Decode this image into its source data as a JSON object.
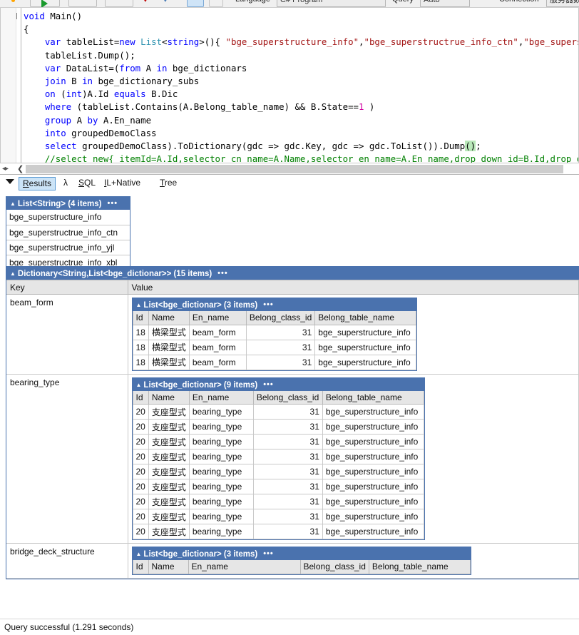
{
  "toolbar": {
    "language_label": "Language",
    "language_value": "C# Program",
    "query_label": "Query",
    "query_value": "Auto",
    "connection_label": "Connection",
    "connection_value": "服务器数据库 ▼",
    "icons": [
      "status-dot",
      "run-icon",
      "stop-icon",
      "cancel-icon",
      "linq-icon",
      "lambda-icon",
      "grid-icon",
      "columns-icon"
    ]
  },
  "editor": {
    "lines": [
      [
        {
          "t": "void ",
          "c": "kw"
        },
        {
          "t": "Main()",
          "c": ""
        }
      ],
      [
        {
          "t": "{",
          "c": ""
        }
      ],
      [
        {
          "t": "    ",
          "c": ""
        },
        {
          "t": "var",
          "c": "kw"
        },
        {
          "t": " tableList=",
          "c": ""
        },
        {
          "t": "new",
          "c": "kw"
        },
        {
          "t": " ",
          "c": ""
        },
        {
          "t": "List",
          "c": "kw2"
        },
        {
          "t": "<",
          "c": ""
        },
        {
          "t": "string",
          "c": "kw"
        },
        {
          "t": ">(){ ",
          "c": ""
        },
        {
          "t": "\"bge_superstructure_info\"",
          "c": "str"
        },
        {
          "t": ",",
          "c": ""
        },
        {
          "t": "\"bge_superstructrue_info_ctn\"",
          "c": "str"
        },
        {
          "t": ",",
          "c": ""
        },
        {
          "t": "\"bge_superstruct",
          "c": "str"
        }
      ],
      [
        {
          "t": "    tableList.Dump();",
          "c": ""
        }
      ],
      [
        {
          "t": "    ",
          "c": ""
        },
        {
          "t": "var",
          "c": "kw"
        },
        {
          "t": " DataList=(",
          "c": ""
        },
        {
          "t": "from",
          "c": "kw"
        },
        {
          "t": " A ",
          "c": ""
        },
        {
          "t": "in",
          "c": "kw"
        },
        {
          "t": " bge_dictionars",
          "c": ""
        }
      ],
      [
        {
          "t": "    ",
          "c": ""
        },
        {
          "t": "join",
          "c": "kw"
        },
        {
          "t": " B ",
          "c": ""
        },
        {
          "t": "in",
          "c": "kw"
        },
        {
          "t": " bge_dictionary_subs",
          "c": ""
        }
      ],
      [
        {
          "t": "    ",
          "c": ""
        },
        {
          "t": "on",
          "c": "kw"
        },
        {
          "t": " (",
          "c": ""
        },
        {
          "t": "int",
          "c": "kw"
        },
        {
          "t": ")A.Id ",
          "c": ""
        },
        {
          "t": "equals",
          "c": "kw"
        },
        {
          "t": " B.Dic",
          "c": ""
        }
      ],
      [
        {
          "t": "    ",
          "c": ""
        },
        {
          "t": "where",
          "c": "kw"
        },
        {
          "t": " (tableList.Contains(A.Belong_table_name) && B.State==",
          "c": ""
        },
        {
          "t": "1",
          "c": "num"
        },
        {
          "t": " )",
          "c": ""
        }
      ],
      [
        {
          "t": "    ",
          "c": ""
        },
        {
          "t": "group",
          "c": "kw"
        },
        {
          "t": " A ",
          "c": ""
        },
        {
          "t": "by",
          "c": "kw"
        },
        {
          "t": " A.En_name",
          "c": ""
        }
      ],
      [
        {
          "t": "    ",
          "c": ""
        },
        {
          "t": "into",
          "c": "kw"
        },
        {
          "t": " groupedDemoClass",
          "c": ""
        }
      ],
      [
        {
          "t": "    ",
          "c": ""
        },
        {
          "t": "select",
          "c": "kw"
        },
        {
          "t": " groupedDemoClass).ToDictionary(gdc => gdc.Key, gdc => gdc.ToList()).Dump",
          "c": ""
        },
        {
          "t": "()",
          "c": "hl"
        },
        {
          "t": ";",
          "c": ""
        }
      ],
      [
        {
          "t": "    //select new{ itemId=A.Id,selector_cn_name=A.Name,selector_en_name=A.En_name,drop_down_id=B.Id,drop_down_",
          "c": "cmt"
        }
      ]
    ]
  },
  "tabs": {
    "items": [
      {
        "label": "Results",
        "underline": "R",
        "active": true
      },
      {
        "label": "λ",
        "underline": "",
        "active": false
      },
      {
        "label": "SQL",
        "underline": "S",
        "active": false
      },
      {
        "label": "IL+Native",
        "underline": "I",
        "active": false
      },
      {
        "label": "Tree",
        "underline": "T",
        "active": false
      }
    ]
  },
  "results": {
    "string_list": {
      "title": "List<String> (4 items)",
      "dots": "•••",
      "items": [
        "bge_superstructure_info",
        "bge_superstructrue_info_ctn",
        "bge_superstructrue_info_yjl",
        "bge_superstructrue_info_xbl"
      ]
    },
    "dictionary": {
      "title": "Dictionary<String,List<bge_dictionar>> (15 items)",
      "dots": "•••",
      "key_header": "Key",
      "value_header": "Value",
      "columns": [
        "Id",
        "Name",
        "En_name",
        "Belong_class_id",
        "Belong_table_name"
      ],
      "entries": [
        {
          "key": "beam_form",
          "inner_title": "List<bge_dictionar> (3 items)",
          "dots": "•••",
          "rows": [
            [
              "18",
              "横梁型式",
              "beam_form",
              "31",
              "bge_superstructure_info"
            ],
            [
              "18",
              "横梁型式",
              "beam_form",
              "31",
              "bge_superstructure_info"
            ],
            [
              "18",
              "横梁型式",
              "beam_form",
              "31",
              "bge_superstructure_info"
            ]
          ]
        },
        {
          "key": "bearing_type",
          "inner_title": "List<bge_dictionar> (9 items)",
          "dots": "•••",
          "rows": [
            [
              "20",
              "支座型式",
              "bearing_type",
              "31",
              "bge_superstructure_info"
            ],
            [
              "20",
              "支座型式",
              "bearing_type",
              "31",
              "bge_superstructure_info"
            ],
            [
              "20",
              "支座型式",
              "bearing_type",
              "31",
              "bge_superstructure_info"
            ],
            [
              "20",
              "支座型式",
              "bearing_type",
              "31",
              "bge_superstructure_info"
            ],
            [
              "20",
              "支座型式",
              "bearing_type",
              "31",
              "bge_superstructure_info"
            ],
            [
              "20",
              "支座型式",
              "bearing_type",
              "31",
              "bge_superstructure_info"
            ],
            [
              "20",
              "支座型式",
              "bearing_type",
              "31",
              "bge_superstructure_info"
            ],
            [
              "20",
              "支座型式",
              "bearing_type",
              "31",
              "bge_superstructure_info"
            ],
            [
              "20",
              "支座型式",
              "bearing_type",
              "31",
              "bge_superstructure_info"
            ]
          ]
        },
        {
          "key": "bridge_deck_structure",
          "inner_title": "List<bge_dictionar> (3 items)",
          "dots": "•••",
          "rows": []
        }
      ]
    }
  },
  "status": {
    "text": "Query successful  (1.291 seconds)"
  },
  "colors": {
    "header_blue": "#4a72ae",
    "tab_active_bg": "#cce4f7",
    "tab_active_border": "#5a9ad4",
    "table_header_gray": "#e6e6e6"
  }
}
